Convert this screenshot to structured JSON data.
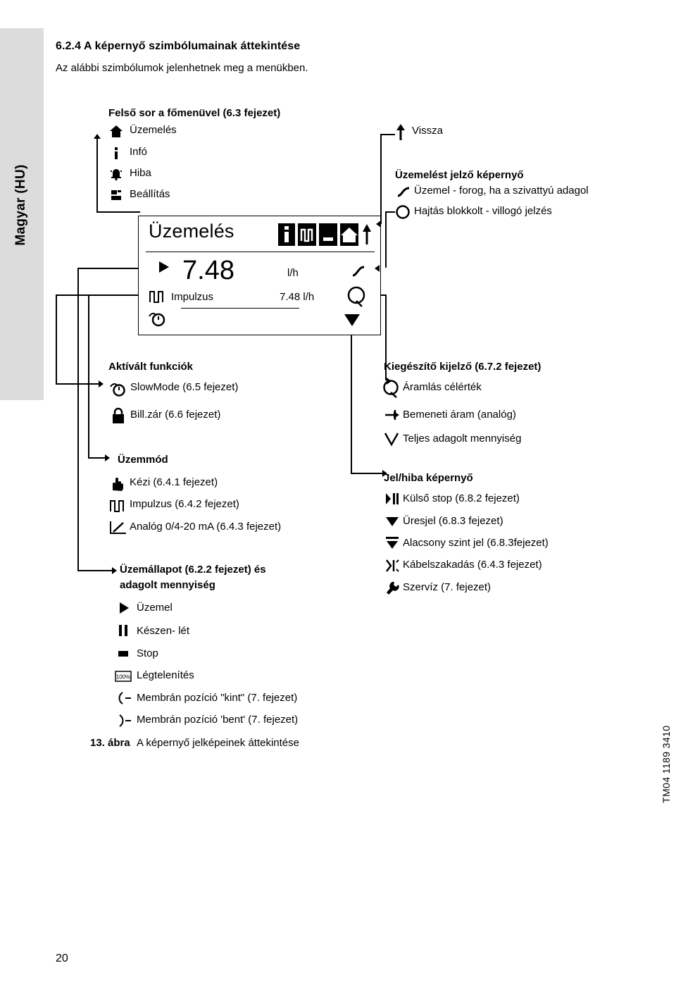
{
  "sidebar": {
    "language_tab": "Magyar (HU)"
  },
  "page": {
    "number": "20",
    "doc_code": "TM04 1189 3410"
  },
  "heading": {
    "section": "6.2.4 A képernyő szimbólumainak áttekintése",
    "intro": "Az alábbi szimbólumok jelenhetnek meg a menükben."
  },
  "top_menu": {
    "title": "Felső sor a főmenüvel (6.3 fejezet)",
    "items": [
      {
        "icon": "home-icon",
        "label": "Üzemelés"
      },
      {
        "icon": "info-icon",
        "label": "Infó"
      },
      {
        "icon": "alarm-icon",
        "label": "Hiba"
      },
      {
        "icon": "settings-icon",
        "label": "Beállítás"
      }
    ]
  },
  "lcd": {
    "title": "Üzemelés",
    "value": "7.48",
    "unit": "l/h",
    "row_label": "Impulzus",
    "row_value": "7.48 l/h",
    "topbar_icons": [
      "info-icon",
      "pulse-icon",
      "stop-icon",
      "home-icon",
      "back-arrow-icon"
    ],
    "side_icons": [
      "running-icon",
      "flow-q-icon"
    ],
    "bottom_icons": [
      "slowmode-icon",
      "down-arrow-icon"
    ]
  },
  "back": {
    "icon": "back-arrow-icon",
    "label": "Vissza"
  },
  "operating_screen": {
    "title": "Üzemelést jelző képernyő",
    "items": [
      {
        "icon": "running-dash-icon",
        "label": "Üzemel - forog, ha a szivattyú adagol"
      },
      {
        "icon": "blocked-circle-icon",
        "label": "Hajtás blokkolt - villogó jelzés"
      }
    ]
  },
  "activated_functions": {
    "title": "Aktívált funkciók",
    "items": [
      {
        "icon": "slowmode-icon",
        "label": "SlowMode (6.5 fejezet)"
      },
      {
        "icon": "lock-icon",
        "label": "Bill.zár (6.6 fejezet)"
      }
    ]
  },
  "operating_mode": {
    "title": "Üzemmód",
    "items": [
      {
        "icon": "hand-icon",
        "label": "Kézi (6.4.1 fejezet)"
      },
      {
        "icon": "pulse-icon",
        "label": "Impulzus (6.4.2 fejezet)"
      },
      {
        "icon": "analog-icon",
        "label": "Analóg 0/4-20 mA (6.4.3 fejezet)"
      }
    ]
  },
  "operating_state": {
    "title_line1": "Üzemállapot (6.2.2 fejezet) és",
    "title_line2": "adagolt mennyiség",
    "items": [
      {
        "icon": "play-icon",
        "label": "Üzemel"
      },
      {
        "icon": "pause-icon",
        "label": "Készen- lét"
      },
      {
        "icon": "stop-icon",
        "label": "Stop"
      },
      {
        "icon": "deaeration-icon",
        "label": "Légtelenítés"
      },
      {
        "icon": "membrane-out-icon",
        "label": "Membrán pozíció \"kint\" (7. fejezet)"
      },
      {
        "icon": "membrane-in-icon",
        "label": "Membrán pozíció 'bent' (7. fejezet)"
      }
    ]
  },
  "additional_display": {
    "title": "Kiegészítő kijelző (6.7.2 fejezet)",
    "items": [
      {
        "icon": "flow-q-icon",
        "label": "Áramlás célérték"
      },
      {
        "icon": "input-current-icon",
        "label": "Bemeneti áram (analóg)"
      },
      {
        "icon": "total-volume-icon",
        "label": "Teljes adagolt mennyiség"
      }
    ]
  },
  "signal_fault": {
    "title": "Jel/hiba képernyő",
    "items": [
      {
        "icon": "external-stop-icon",
        "label": "Külső stop (6.8.2 fejezet)"
      },
      {
        "icon": "empty-signal-icon",
        "label": "Üresjel (6.8.3 fejezet)"
      },
      {
        "icon": "low-level-icon",
        "label": "Alacsony szint jel (6.8.3fejezet)"
      },
      {
        "icon": "cable-break-icon",
        "label": "Kábelszakadás (6.4.3 fejezet)"
      },
      {
        "icon": "service-icon",
        "label": "Szervíz (7. fejezet)"
      }
    ]
  },
  "figure": {
    "number": "13. ábra",
    "caption": "A képernyő jelképeinek áttekintése"
  }
}
